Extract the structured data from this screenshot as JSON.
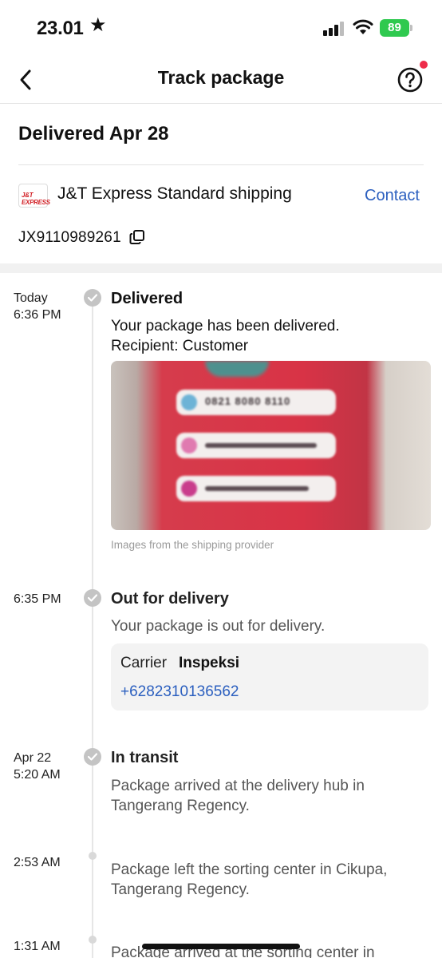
{
  "status_bar": {
    "time": "23.01",
    "battery": "89"
  },
  "nav": {
    "title": "Track package"
  },
  "summary": {
    "heading": "Delivered Apr 28",
    "carrier_logo_text": "J&T EXPRESS",
    "carrier_name": "J&T Express Standard shipping",
    "contact_label": "Contact",
    "tracking_number": "JX9110989261"
  },
  "events": [
    {
      "time_line1": "Today",
      "time_line2": "6:36 PM",
      "title": "Delivered",
      "desc_line1": "Your package has been delivered.",
      "desc_line2": "Recipient: Customer",
      "photo_caption": "Images from the shipping provider",
      "photo_text": "0821 8080 8110"
    },
    {
      "time_line1": "6:35 PM",
      "title": "Out for delivery",
      "desc_line1": "Your package is out for delivery.",
      "carrier_label": "Carrier",
      "carrier_name": "Inspeksi",
      "carrier_phone": "+6282310136562"
    },
    {
      "time_line1": "Apr 22",
      "time_line2": "5:20 AM",
      "title": "In transit",
      "desc_line1": "Package arrived at the delivery hub in",
      "desc_line2": "Tangerang Regency."
    },
    {
      "time_line1": "2:53 AM",
      "desc_line1": "Package left the sorting center in Cikupa,",
      "desc_line2": "Tangerang Regency."
    },
    {
      "time_line1": "1:31 AM",
      "desc_line1": "Package arrived at the sorting center in"
    }
  ],
  "colors": {
    "accent": "#2b5fbf",
    "battery": "#2fc94f",
    "notification": "#ee2c4a"
  }
}
